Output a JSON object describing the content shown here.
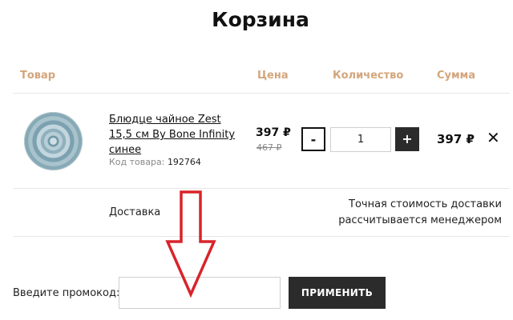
{
  "page": {
    "title": "Корзина"
  },
  "columns": {
    "product": "Товар",
    "price": "Цена",
    "quantity": "Количество",
    "total": "Сумма"
  },
  "cart_item": {
    "name": "Блюдце чайное Zest 15,5 см By Bone Infinity синее",
    "sku_label": "Код товара:",
    "sku": "192764",
    "price_current": "397 ₽",
    "price_old": "467 ₽",
    "qty_minus": "-",
    "qty_plus": "+",
    "quantity": "1",
    "line_total": "397 ₽",
    "remove_symbol": "✕"
  },
  "delivery": {
    "label": "Доставка",
    "note_line1": "Точная стоимость доставки",
    "note_line2": "рассчитывается менеджером"
  },
  "promo": {
    "label": "Введите промокод:",
    "value": "",
    "apply_label": "ПРИМЕНИТЬ"
  },
  "colors": {
    "column_header": "#d3a57a",
    "dark_button": "#2b2b2b",
    "annotation_arrow": "#d9232a"
  },
  "icons": {
    "annotation": "down-arrow-icon",
    "remove": "close-icon"
  }
}
